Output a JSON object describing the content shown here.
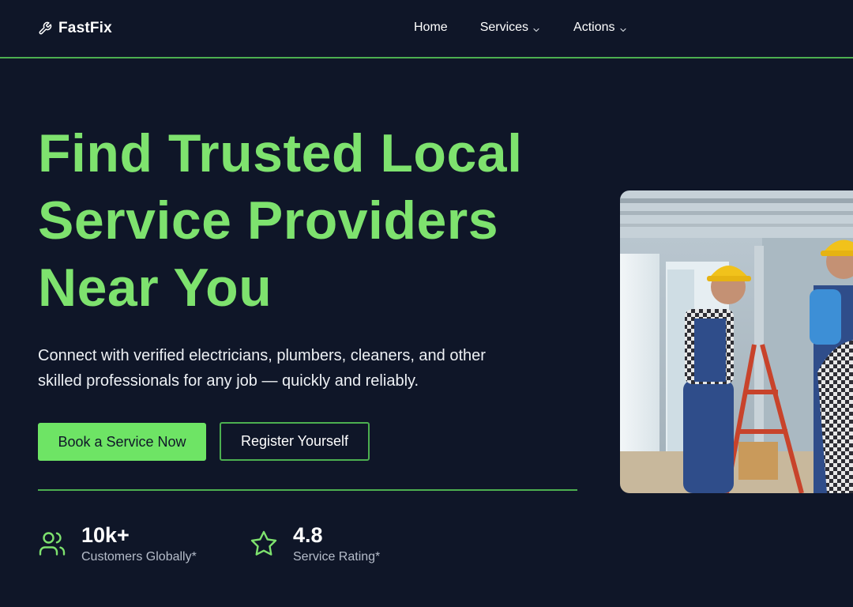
{
  "navbar": {
    "brand_name": "FastFix",
    "brand_icon": "wrench-icon",
    "links": [
      {
        "label": "Home",
        "has_dropdown": false
      },
      {
        "label": "Services",
        "has_dropdown": true
      },
      {
        "label": "Actions",
        "has_dropdown": true
      }
    ]
  },
  "hero": {
    "title_lines": [
      "Find Trusted Local",
      "Service Providers",
      "Near You"
    ],
    "description_lines": [
      "Connect with verified electricians, plumbers, cleaners, and other",
      "skilled professionals for any job — quickly and reliably."
    ],
    "primary_button": "Book a Service Now",
    "secondary_button": "Register Yourself"
  },
  "stats": [
    {
      "value": "10k+",
      "label": "Customers Globally*",
      "icon": "users-icon"
    },
    {
      "value": "4.8",
      "label": "Service Rating*",
      "icon": "star-icon"
    }
  ],
  "colors": {
    "background": "#0f1628",
    "accent_green": "#7ee26e",
    "button_green": "#6ee465",
    "border_green": "#4caf50"
  }
}
